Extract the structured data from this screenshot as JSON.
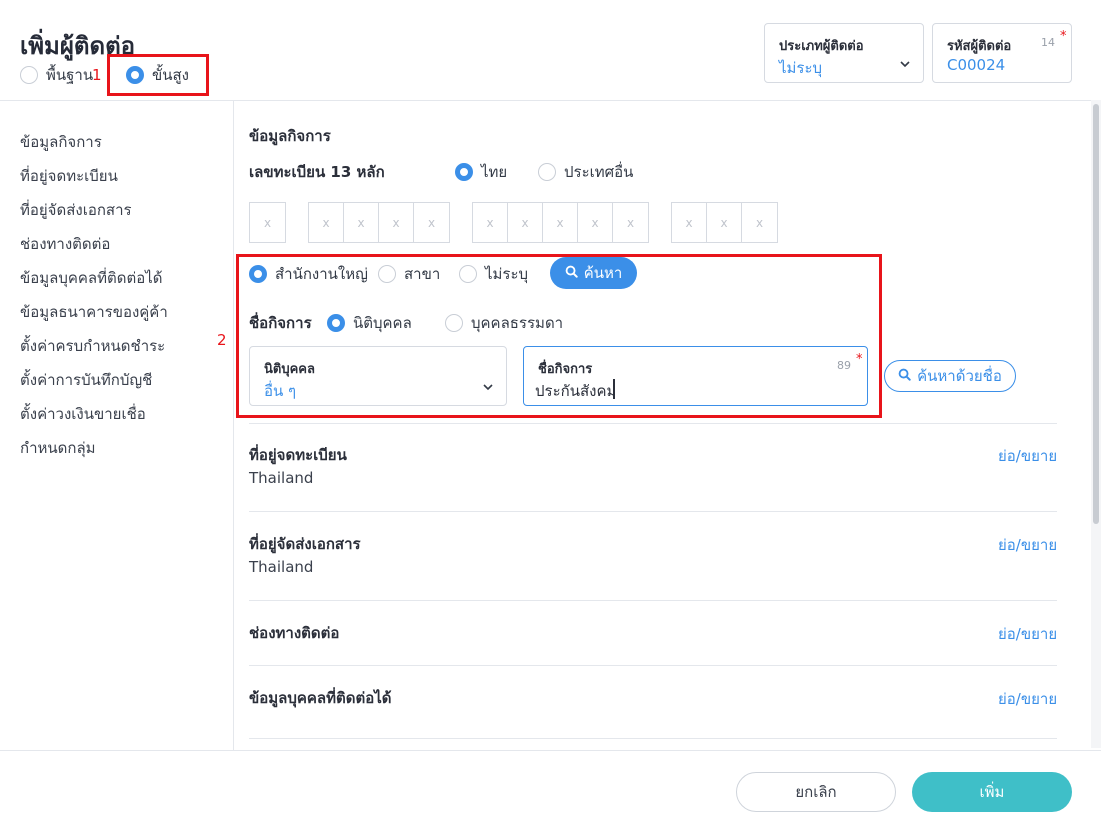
{
  "header": {
    "title": "เพิ่มผู้ติดต่อ",
    "mode_basic": "พื้นฐาน",
    "mode_advanced": "ขั้นสูง",
    "annotation_1": "1",
    "contact_type_label": "ประเภทผู้ติดต่อ",
    "contact_type_value": "ไม่ระบุ",
    "contact_code_label": "รหัสผู้ติดต่อ",
    "contact_code_value": "C00024",
    "contact_code_counter": "14",
    "required_mark": "*"
  },
  "sidebar": {
    "items": [
      {
        "label": "ข้อมูลกิจการ"
      },
      {
        "label": "ที่อยู่จดทะเบียน"
      },
      {
        "label": "ที่อยู่จัดส่งเอกสาร"
      },
      {
        "label": "ช่องทางติดต่อ"
      },
      {
        "label": "ข้อมูลบุคคลที่ติดต่อได้"
      },
      {
        "label": "ข้อมูลธนาคารของคู่ค้า"
      },
      {
        "label": "ตั้งค่าครบกำหนดชำระ"
      },
      {
        "label": "ตั้งค่าการบันทึกบัญชี"
      },
      {
        "label": "ตั้งค่าวงเงินขายเชื่อ"
      },
      {
        "label": "กำหนดกลุ่ม"
      }
    ]
  },
  "business": {
    "section_title": "ข้อมูลกิจการ",
    "tax_id_label": "เลขทะเบียน 13 หลัก",
    "country_thai": "ไทย",
    "country_other": "ประเทศอื่น",
    "tax_placeholder": "x",
    "branch_head": "สำนักงานใหญ่",
    "branch_branch": "สาขา",
    "branch_none": "ไม่ระบุ",
    "search_button": "ค้นหา",
    "annotation_2": "2",
    "name_label": "ชื่อกิจการ",
    "entity_juristic": "นิติบุคคล",
    "entity_person": "บุคคลธรรมดา",
    "juristic_type_label": "นิติบุคคล",
    "juristic_type_value": "อื่น ๆ",
    "business_name_label": "ชื่อกิจการ",
    "business_name_value": "ประกันสังคม",
    "business_name_counter": "89",
    "search_by_name_button": "ค้นหาด้วยชื่อ"
  },
  "sections": [
    {
      "title": "ที่อยู่จดทะเบียน",
      "sub": "Thailand",
      "toggle": "ย่อ/ขยาย"
    },
    {
      "title": "ที่อยู่จัดส่งเอกสาร",
      "sub": "Thailand",
      "toggle": "ย่อ/ขยาย"
    },
    {
      "title": "ช่องทางติดต่อ",
      "toggle": "ย่อ/ขยาย"
    },
    {
      "title": "ข้อมูลบุคคลที่ติดต่อได้",
      "toggle": "ย่อ/ขยาย"
    }
  ],
  "footer": {
    "cancel": "ยกเลิก",
    "add": "เพิ่ม"
  },
  "colors": {
    "accent": "#3b8fe8",
    "primary_button": "#3fbfc8",
    "annotation": "#e8141a"
  }
}
